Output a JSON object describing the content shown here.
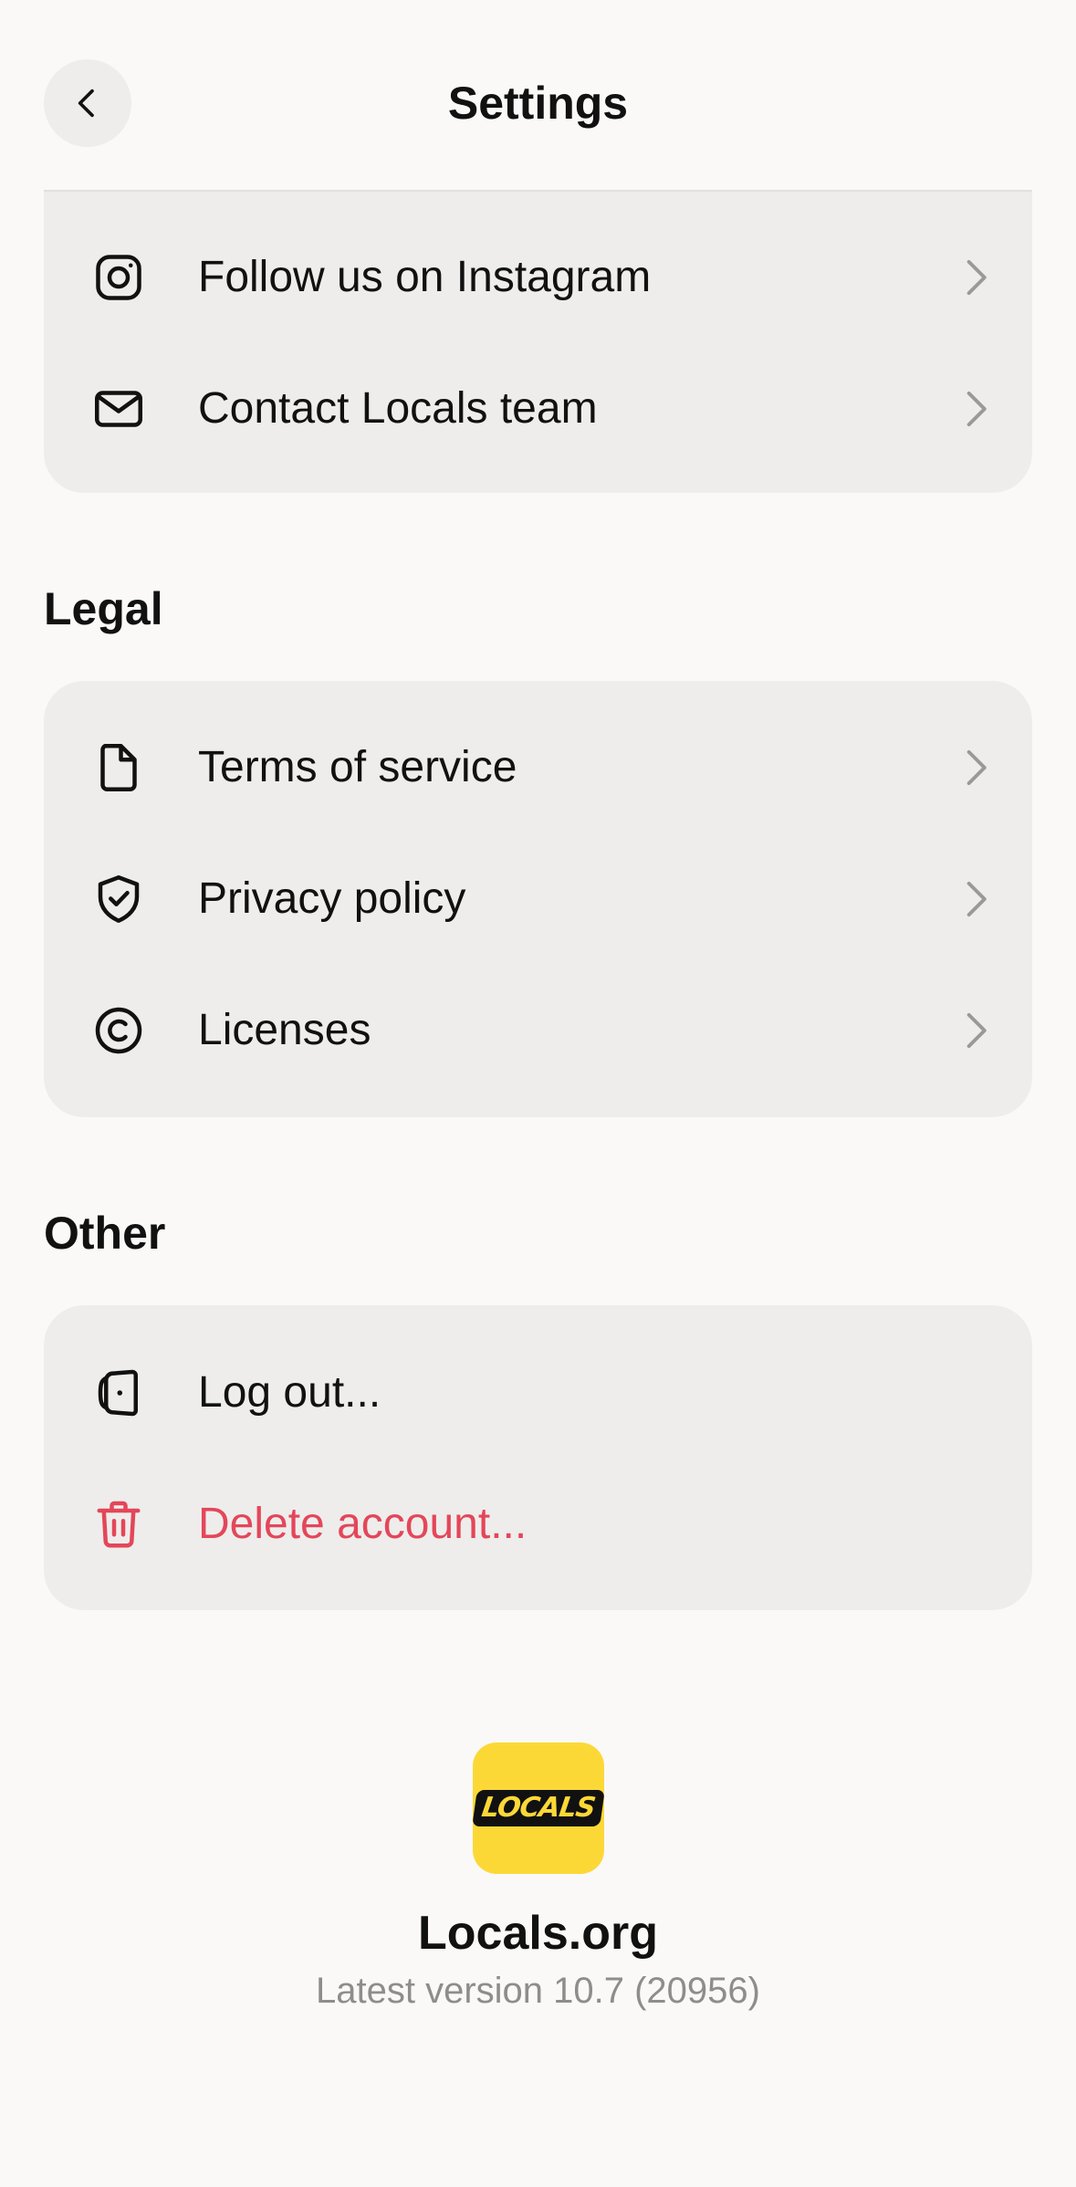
{
  "header": {
    "title": "Settings"
  },
  "top_card": {
    "items": [
      {
        "label": "Follow us on Instagram",
        "icon": "instagram-icon"
      },
      {
        "label": "Contact Locals team",
        "icon": "mail-icon"
      }
    ]
  },
  "legal": {
    "heading": "Legal",
    "items": [
      {
        "label": "Terms of service",
        "icon": "document-icon"
      },
      {
        "label": "Privacy policy",
        "icon": "shield-check-icon"
      },
      {
        "label": "Licenses",
        "icon": "copyright-icon"
      }
    ]
  },
  "other": {
    "heading": "Other",
    "items": [
      {
        "label": "Log out...",
        "icon": "logout-door-icon"
      },
      {
        "label": "Delete account...",
        "icon": "trash-icon"
      }
    ]
  },
  "footer": {
    "logo_text": "LOCALS",
    "app_name": "Locals.org",
    "version": "Latest version 10.7 (20956)"
  },
  "colors": {
    "background": "#faf9f8",
    "card": "#eeedec",
    "danger": "#e34759",
    "brand_yellow": "#fcd837",
    "muted_text": "#8e8d8b"
  }
}
